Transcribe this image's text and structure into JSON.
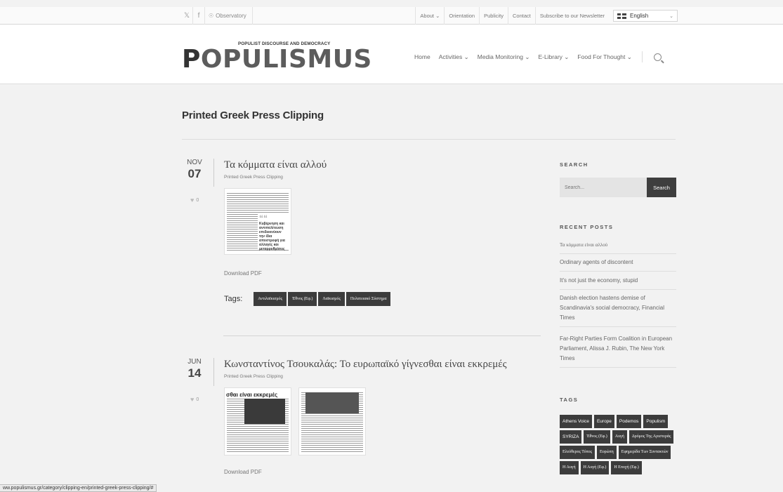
{
  "topbar": {
    "observatory": "Observatory",
    "menu": [
      "About",
      "Orientation",
      "Publicity",
      "Contact",
      "Subscribe to our Newsletter"
    ],
    "about_chevron": "⌄",
    "language": "English"
  },
  "logo": {
    "tagline": "POPULIST DISCOURSE AND DEMOCRACY",
    "first": "P",
    "rest": "OPULISMUS"
  },
  "nav": {
    "items": [
      "Home",
      "Activities",
      "Media Monitoring",
      "E-Library",
      "Food For Thought"
    ],
    "chevron": "⌄"
  },
  "page": {
    "title": "Printed Greek Press Clipping"
  },
  "posts": [
    {
      "month": "NOV",
      "day": "07",
      "likes": "0",
      "title": "Τα κόμματα είναι αλλού",
      "category": "Printed Greek Press Clipping",
      "quote": "Κυβέρνηση και αντιπολίτευση επιδεικνύουν την ίδια αποστροφή για αλλαγές και μεταρρυθμίσεις",
      "download": "Download PDF",
      "tags_label": "Tags:",
      "tags": [
        "Αντιλαϊκισμός",
        "Έθνος (Εφ.)",
        "Λαϊκισμός",
        "Πελατειακό Σύστημα"
      ]
    },
    {
      "month": "JUN",
      "day": "14",
      "likes": "0",
      "title": "Κωνσταντίνος Τσουκαλάς: Το ευρωπαϊκό γίγνεσθαι είναι εκκρεμές",
      "category": "Printed Greek Press Clipping",
      "headline": "σθαι είναι εκκρεμές",
      "download": "Download PDF"
    }
  ],
  "sidebar": {
    "search_heading": "SEARCH",
    "search_placeholder": "Search...",
    "search_button": "Search",
    "recent_heading": "RECENT POSTS",
    "recent": [
      "Τα κόμματα είναι αλλού",
      "Ordinary agents of discontent",
      "It's not just the economy, stupid",
      "Danish election hastens demise of Scandinavia's social democracy, Financial Times",
      "Far-Right Parties Form Coalition in European Parliament, Alissa J. Rubin, The New York Times"
    ],
    "tags_heading": "TAGS",
    "tags": [
      "Athens Voice",
      "Europe",
      "Podemos",
      "Populism",
      "SYRIZA",
      "Έθνος (Εφ.)",
      "Αυγή",
      "Δρόμος Της Αριστεράς",
      "Ελεύθερος Τύπος",
      "Ευρώπη",
      "Εφημερίδα Των Συντακτών",
      "Η Αυγή",
      "Η Αυγή (Εφ.)",
      "Η Εποχή (Εφ.)"
    ]
  },
  "statusbar": {
    "url": "ww.populismus.gr/category/clipping-en/printed-greek-press-clipping/#"
  },
  "icons": {
    "twitter": "twitter-icon",
    "facebook": "facebook-icon",
    "search": "search-icon",
    "heart": "heart-icon"
  }
}
